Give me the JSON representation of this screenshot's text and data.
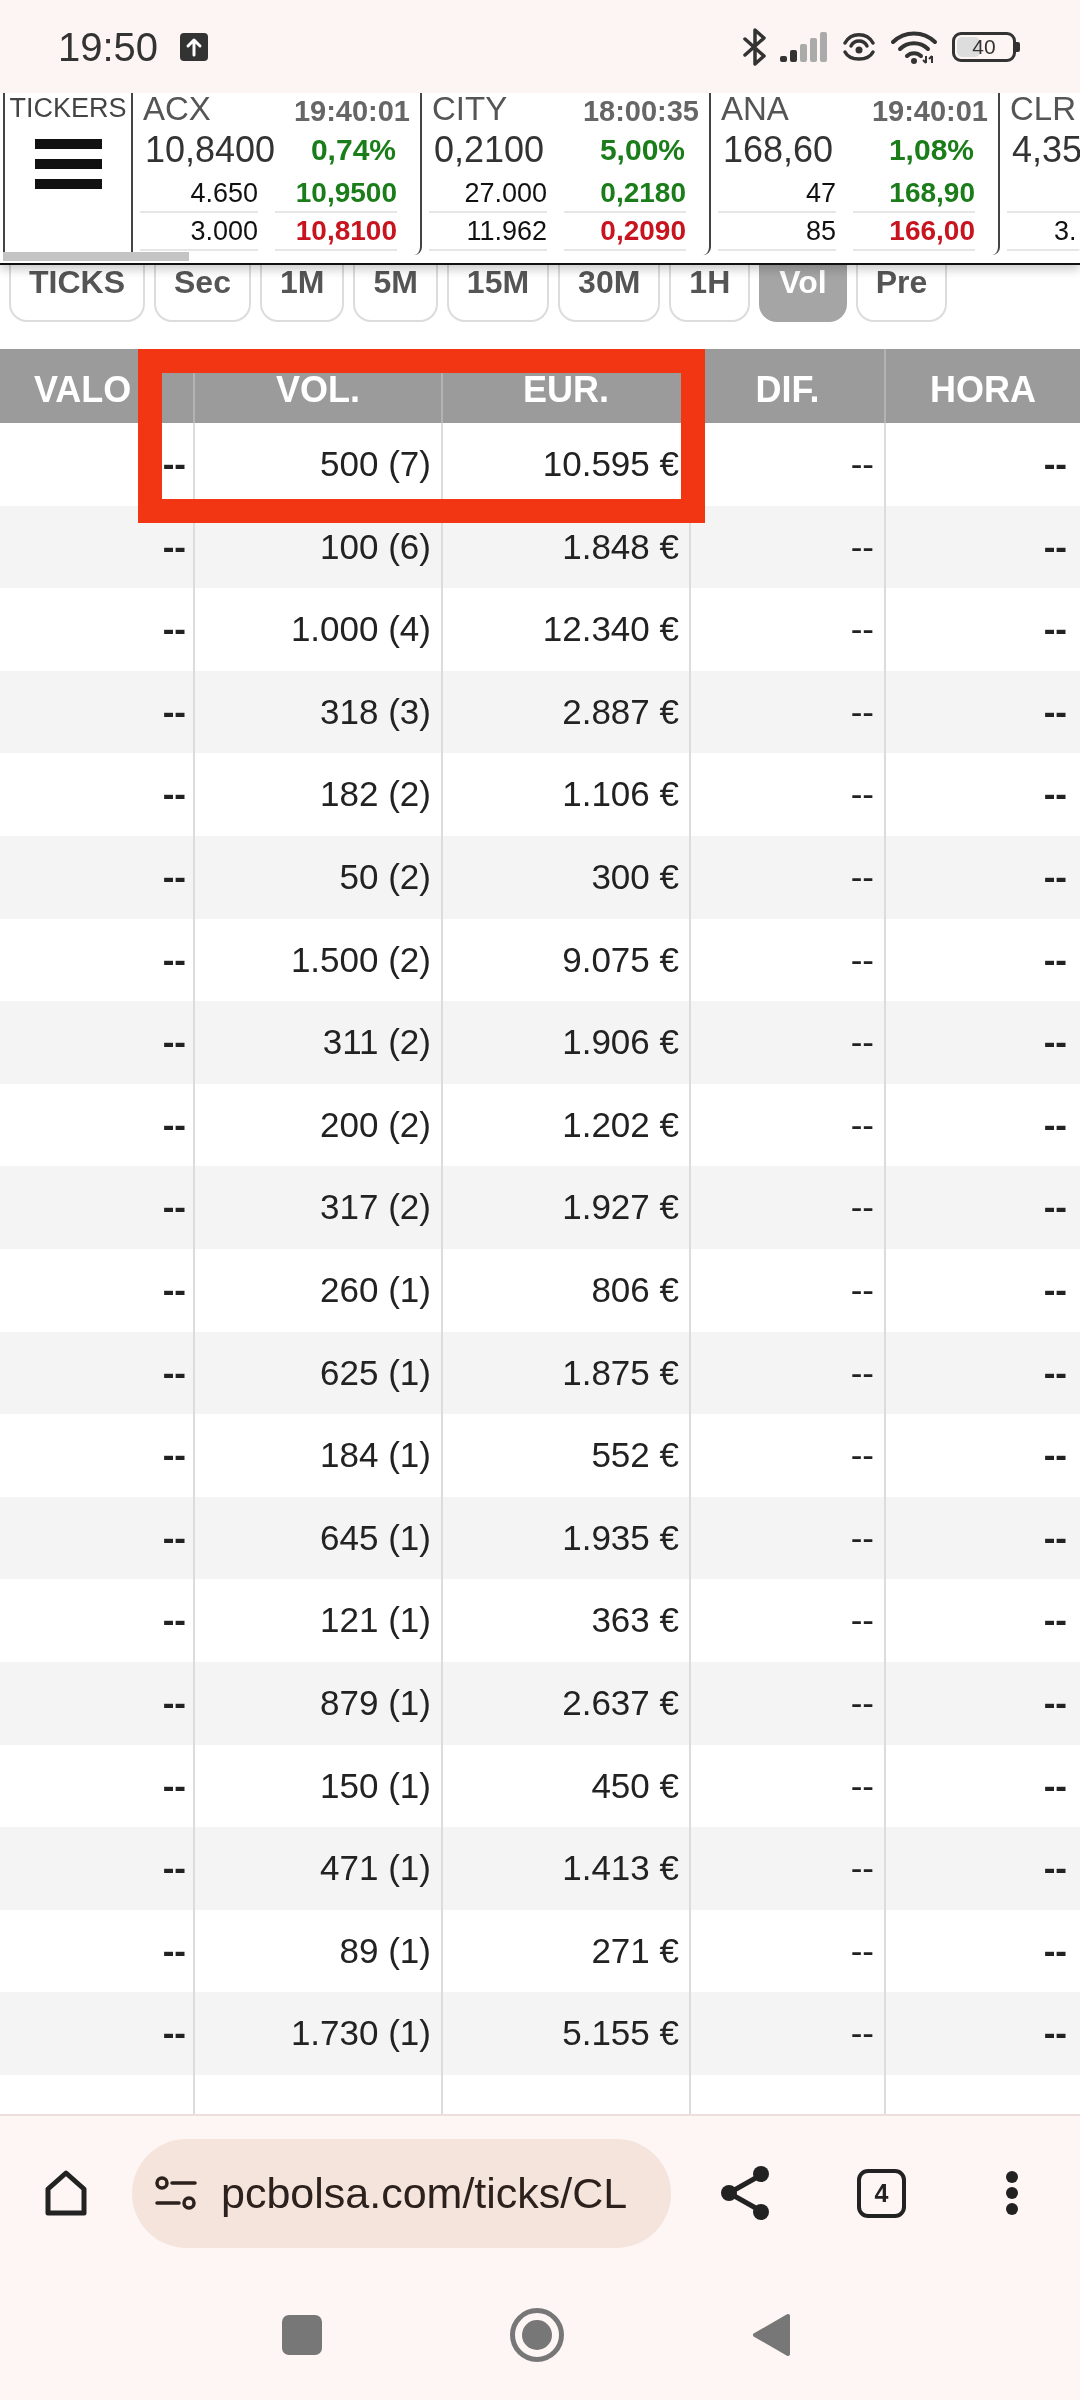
{
  "status_bar": {
    "time": "19:50",
    "battery": "40"
  },
  "ticker_strip": {
    "menu_label": "TICKERS",
    "tickers": [
      {
        "symbol": "ACX",
        "time": "19:40:01",
        "price": "10,8400",
        "change": "0,74%",
        "upper_volume": "4.650",
        "upper_quote": "10,9500",
        "lower_volume": "3.000",
        "lower_quote": "10,8100"
      },
      {
        "symbol": "CITY",
        "time": "18:00:35",
        "price": "0,2100",
        "change": "5,00%",
        "upper_volume": "27.000",
        "upper_quote": "0,2180",
        "lower_volume": "11.962",
        "lower_quote": "0,2090"
      },
      {
        "symbol": "ANA",
        "time": "19:40:01",
        "price": "168,60",
        "change": "1,08%",
        "upper_volume": "47",
        "upper_quote": "168,90",
        "lower_volume": "85",
        "lower_quote": "166,00"
      },
      {
        "symbol": "CLR",
        "price": "4,35",
        "lower_volume": "3."
      }
    ]
  },
  "tabs": [
    {
      "label": "TICKS",
      "selected": false
    },
    {
      "label": "Sec",
      "selected": false
    },
    {
      "label": "1M",
      "selected": false
    },
    {
      "label": "5M",
      "selected": false
    },
    {
      "label": "15M",
      "selected": false
    },
    {
      "label": "30M",
      "selected": false
    },
    {
      "label": "1H",
      "selected": false
    },
    {
      "label": "Vol",
      "selected": true
    },
    {
      "label": "Pre",
      "selected": false
    }
  ],
  "table": {
    "columns": [
      "VALO",
      "VOL.",
      "EUR.",
      "DIF.",
      "HORA"
    ],
    "rows": [
      {
        "valo": "--",
        "vol": "500 (7)",
        "eur": "10.595 €",
        "dif": "--",
        "hora": "--"
      },
      {
        "valo": "--",
        "vol": "100 (6)",
        "eur": "1.848 €",
        "dif": "--",
        "hora": "--"
      },
      {
        "valo": "--",
        "vol": "1.000 (4)",
        "eur": "12.340 €",
        "dif": "--",
        "hora": "--"
      },
      {
        "valo": "--",
        "vol": "318 (3)",
        "eur": "2.887 €",
        "dif": "--",
        "hora": "--"
      },
      {
        "valo": "--",
        "vol": "182 (2)",
        "eur": "1.106 €",
        "dif": "--",
        "hora": "--"
      },
      {
        "valo": "--",
        "vol": "50 (2)",
        "eur": "300 €",
        "dif": "--",
        "hora": "--"
      },
      {
        "valo": "--",
        "vol": "1.500 (2)",
        "eur": "9.075 €",
        "dif": "--",
        "hora": "--"
      },
      {
        "valo": "--",
        "vol": "311 (2)",
        "eur": "1.906 €",
        "dif": "--",
        "hora": "--"
      },
      {
        "valo": "--",
        "vol": "200 (2)",
        "eur": "1.202 €",
        "dif": "--",
        "hora": "--"
      },
      {
        "valo": "--",
        "vol": "317 (2)",
        "eur": "1.927 €",
        "dif": "--",
        "hora": "--"
      },
      {
        "valo": "--",
        "vol": "260 (1)",
        "eur": "806 €",
        "dif": "--",
        "hora": "--"
      },
      {
        "valo": "--",
        "vol": "625 (1)",
        "eur": "1.875 €",
        "dif": "--",
        "hora": "--"
      },
      {
        "valo": "--",
        "vol": "184 (1)",
        "eur": "552 €",
        "dif": "--",
        "hora": "--"
      },
      {
        "valo": "--",
        "vol": "645 (1)",
        "eur": "1.935 €",
        "dif": "--",
        "hora": "--"
      },
      {
        "valo": "--",
        "vol": "121 (1)",
        "eur": "363 €",
        "dif": "--",
        "hora": "--"
      },
      {
        "valo": "--",
        "vol": "879 (1)",
        "eur": "2.637 €",
        "dif": "--",
        "hora": "--"
      },
      {
        "valo": "--",
        "vol": "150 (1)",
        "eur": "450 €",
        "dif": "--",
        "hora": "--"
      },
      {
        "valo": "--",
        "vol": "471 (1)",
        "eur": "1.413 €",
        "dif": "--",
        "hora": "--"
      },
      {
        "valo": "--",
        "vol": "89 (1)",
        "eur": "271 €",
        "dif": "--",
        "hora": "--"
      },
      {
        "valo": "--",
        "vol": "1.730 (1)",
        "eur": "5.155 €",
        "dif": "--",
        "hora": "--"
      }
    ]
  },
  "annotation": {
    "kind": "rectangle"
  },
  "browser_bar": {
    "url": "pcbolsa.com/ticks/CL",
    "tab_count": "4"
  }
}
